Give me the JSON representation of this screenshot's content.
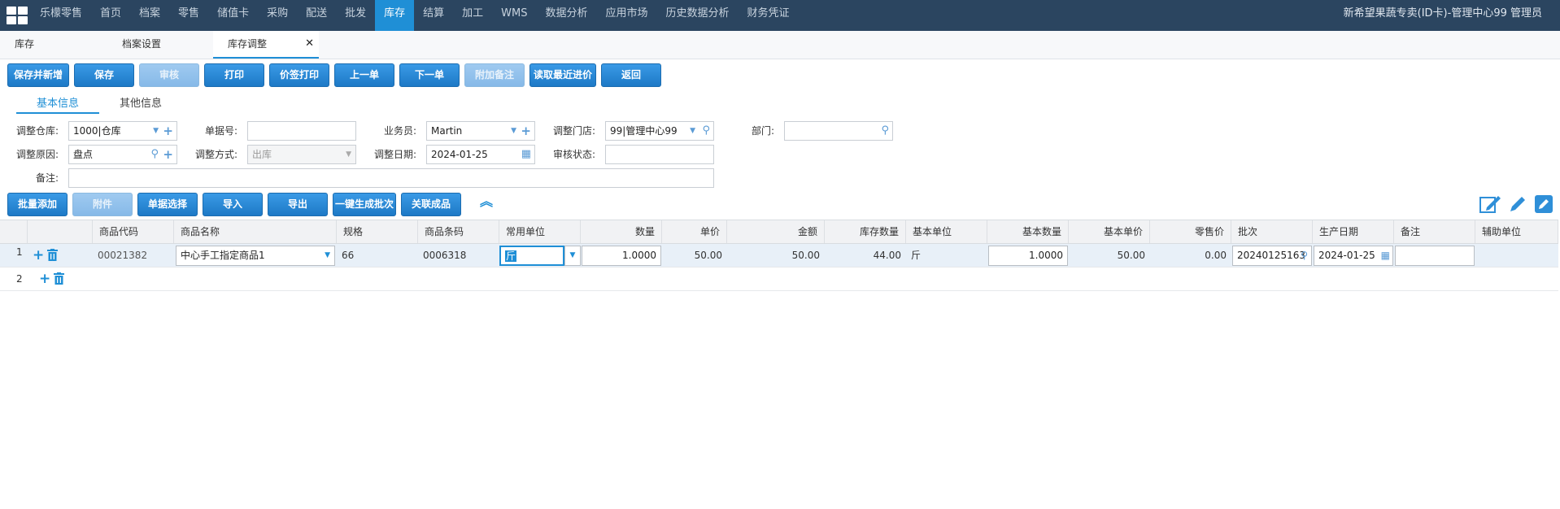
{
  "top_menu": {
    "items": [
      "乐檬零售",
      "首页",
      "档案",
      "零售",
      "储值卡",
      "采购",
      "配送",
      "批发",
      "库存",
      "结算",
      "加工",
      "WMS",
      "数据分析",
      "应用市场",
      "历史数据分析",
      "财务凭证"
    ],
    "active": "库存",
    "user": "新希望果蔬专卖(ID卡)-管理中心99 管理员"
  },
  "page_tabs": [
    "库存",
    "档案设置",
    "库存调整"
  ],
  "toolbar": [
    "保存并新增",
    "保存",
    "审核",
    "打印",
    "价签打印",
    "上一单",
    "下一单",
    "附加备注",
    "读取最近进价",
    "返回"
  ],
  "sub_tabs": [
    "基本信息",
    "其他信息"
  ],
  "form": {
    "warehouse_label": "调整仓库:",
    "warehouse": "1000|仓库",
    "order_no_label": "单据号:",
    "order_no": "",
    "salesman_label": "业务员:",
    "salesman": "Martin",
    "store_label": "调整门店:",
    "store": "99|管理中心99",
    "dept_label": "部门:",
    "dept": "",
    "reason_label": "调整原因:",
    "reason": "盘点",
    "method_label": "调整方式:",
    "method": "出库",
    "date_label": "调整日期:",
    "date": "2024-01-25",
    "status_label": "审核状态:",
    "status": "",
    "remark_label": "备注:",
    "remark": ""
  },
  "grid_toolbar": [
    "批量添加",
    "附件",
    "单据选择",
    "导入",
    "导出",
    "一键生成批次",
    "关联成品"
  ],
  "columns": [
    "商品代码",
    "商品名称",
    "规格",
    "商品条码",
    "常用单位",
    "数量",
    "单价",
    "金额",
    "库存数量",
    "基本单位",
    "基本数量",
    "基本单价",
    "零售价",
    "批次",
    "生产日期",
    "备注",
    "辅助单位"
  ],
  "rows": [
    {
      "num": "1",
      "code": "00021382",
      "name": "中心手工指定商品1",
      "spec": "66",
      "barcode": "0006318",
      "unit": "斤",
      "qty": "1.0000",
      "price": "50.00",
      "amount": "50.00",
      "stock": "44.00",
      "base_unit": "斤",
      "base_qty": "1.0000",
      "base_price": "50.00",
      "retail": "0.00",
      "batch": "20240125163",
      "prod_date": "2024-01-25",
      "remark": "",
      "aux_unit": ""
    },
    {
      "num": "2"
    }
  ],
  "colors": {
    "topbar": "#2b4560",
    "accent": "#1f8fd6"
  },
  "icons": [
    "grid-logo-icon",
    "close-icon",
    "plus-icon",
    "trash-icon",
    "search-icon",
    "calendar-icon",
    "dropdown-arrow-icon",
    "collapse-up-icon",
    "edit-icon",
    "pencil-icon",
    "edit-square-icon"
  ]
}
